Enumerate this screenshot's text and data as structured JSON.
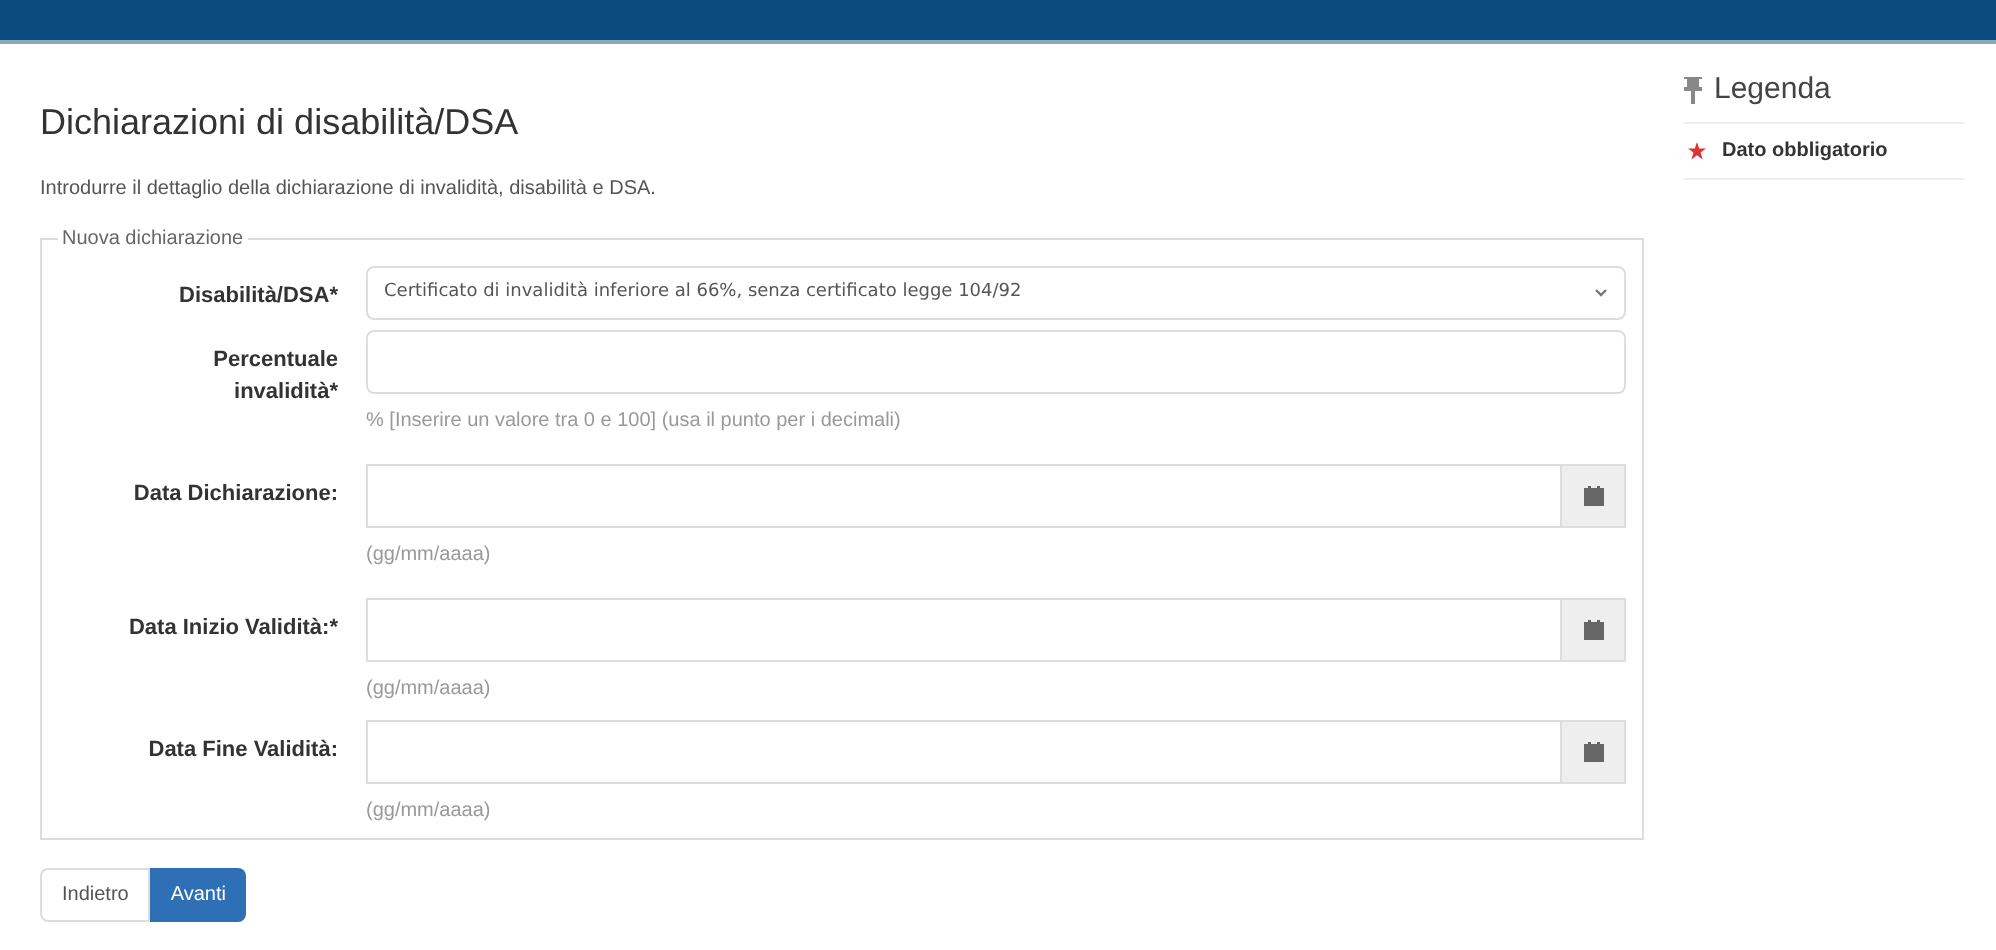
{
  "page": {
    "title": "Dichiarazioni di disabilità/DSA",
    "description": "Introdurre il dettaglio della dichiarazione di invalidità, disabilità e DSA."
  },
  "fieldset": {
    "legend": "Nuova dichiarazione",
    "fields": [
      {
        "kind": "select",
        "label": "Disabilità/DSA*",
        "value": "Certificato di invalidità inferiore al 66%, senza certificato legge 104/92"
      },
      {
        "kind": "text",
        "label": "Percentuale invalidità*",
        "hint": "% [Inserire un valore tra 0 e 100] (usa il punto per i decimali)"
      },
      {
        "kind": "date",
        "label": "Data Dichiarazione:",
        "hint": "(gg/mm/aaaa)"
      },
      {
        "kind": "date",
        "label": "Data Inizio Validità:*",
        "hint": "(gg/mm/aaaa)"
      },
      {
        "kind": "date",
        "label": "Data Fine Validità:",
        "hint": "(gg/mm/aaaa)"
      }
    ]
  },
  "buttons": [
    {
      "label": "Indietro",
      "kind": "default"
    },
    {
      "label": "Avanti",
      "kind": "primary"
    }
  ],
  "legend": {
    "title": "Legenda",
    "items": [
      {
        "label": "Dato obbligatorio"
      }
    ]
  }
}
